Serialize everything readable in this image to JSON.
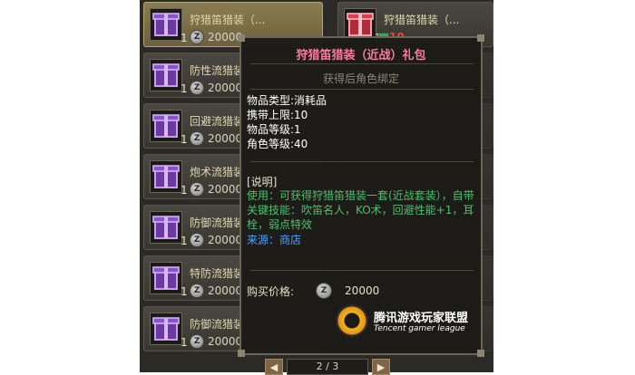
{
  "items": [
    {
      "name": "狩猎笛猎装（...",
      "qty": "1",
      "price": "20000"
    },
    {
      "name": "防性流猎装",
      "qty": "1",
      "price": "20000"
    },
    {
      "name": "回避流猎装",
      "qty": "1",
      "price": "20000"
    },
    {
      "name": "炮术流猎装",
      "qty": "1",
      "price": "20000"
    },
    {
      "name": "防御流猎装",
      "qty": "1",
      "price": "20000"
    },
    {
      "name": "特防流猎装",
      "qty": "1",
      "price": "20000"
    },
    {
      "name": "防御流猎装",
      "qty": "1",
      "price": "20000"
    }
  ],
  "right_item": {
    "name": "狩猎笛猎装（...",
    "qty": "1",
    "limit": "10"
  },
  "tooltip": {
    "title": "狩猎笛猎装（近战）礼包",
    "bind": "获得后角色绑定",
    "type_label": "物品类型:",
    "type_value": "消耗品",
    "limit_label": "携带上限:",
    "limit_value": "10",
    "item_level_label": "物品等级:",
    "item_level_value": "1",
    "char_level_label": "角色等级:",
    "char_level_value": "40",
    "desc_header": "[说明]",
    "desc": "使用：可获得狩猎笛猎装一套(近战套装），自带关键技能：吹笛名人，KO术，回避性能+1，耳栓，弱点特效",
    "source": "来源：商店",
    "buy_label": "购买价格:",
    "buy_price": "20000"
  },
  "coin_symbol": "Z",
  "logo": {
    "cn": "腾讯游戏玩家联盟",
    "en": "Tencent gamer league"
  },
  "pager": {
    "prev": "◀",
    "next": "▶",
    "text": "2 / 3"
  },
  "colors": {
    "title": "#ff7aa0",
    "desc": "#4ec06a",
    "source": "#4ea0ff",
    "limit": "#ff3c3c"
  }
}
